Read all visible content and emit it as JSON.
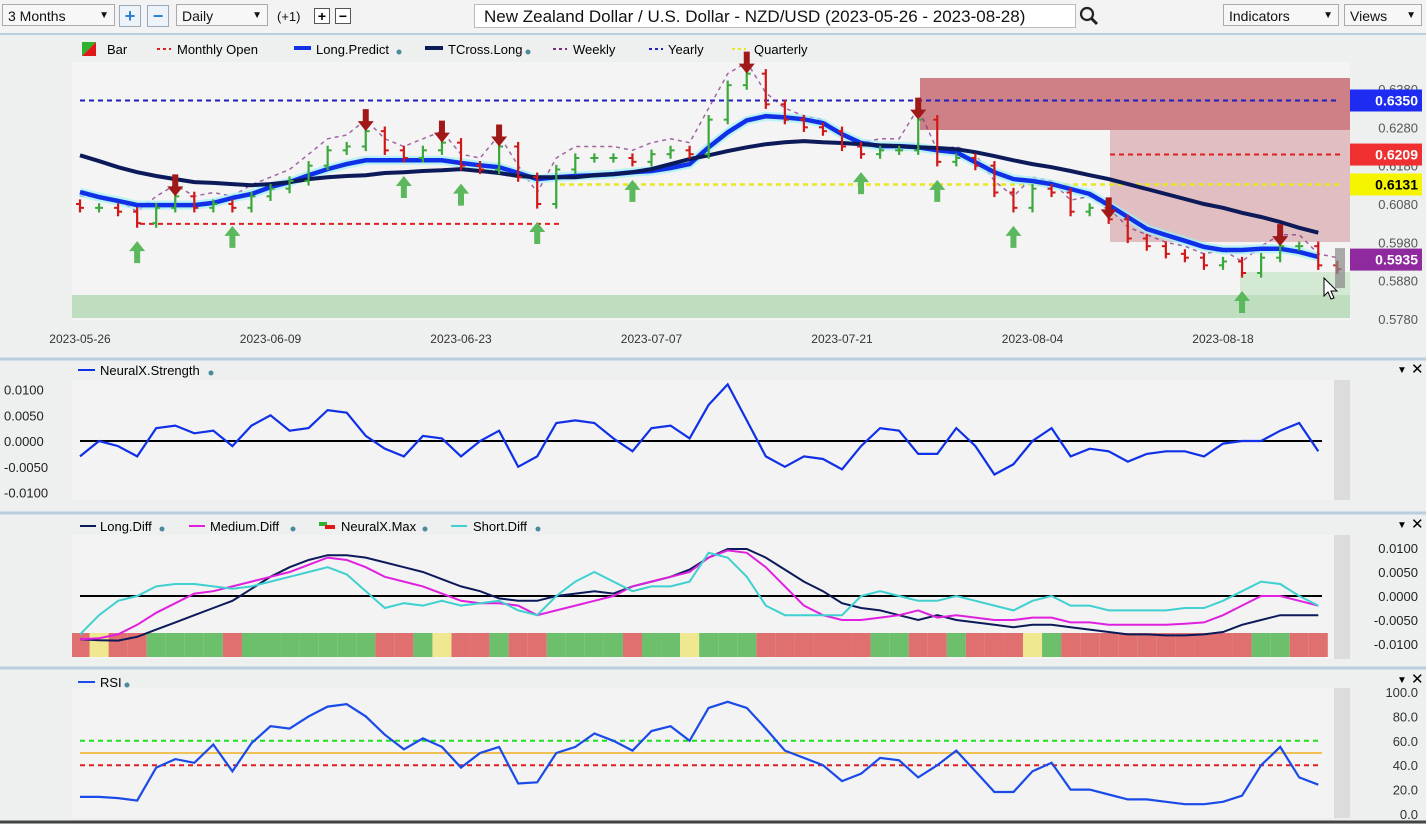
{
  "toolbar": {
    "range_select": "3 Months",
    "interval_select": "Daily",
    "offset_label": "(+1)",
    "title": "New Zealand Dollar / U.S. Dollar - NZD/USD (2023-05-26 - 2023-08-28)",
    "indicators_label": "Indicators",
    "views_label": "Views",
    "icons": [
      "plus-icon",
      "minus-icon",
      "search-icon",
      "chevron-down-icon"
    ]
  },
  "colors": {
    "up": "#3aa83a",
    "down": "#d01818",
    "long_predict": "#1030e8",
    "tcross": "#0c1a5a",
    "yearly": "#2020c0",
    "monthly": "#e02020",
    "quarterly": "#e8e820",
    "weekly": "#7a2a80",
    "long_diff": "#0c1a5a",
    "medium_diff": "#e020e0",
    "short_diff": "#40d0d0",
    "rsi": "#1a4ae8",
    "max_G": "#6cc06c",
    "max_R": "#e07070",
    "max_Y": "#f0e890"
  },
  "chart_data": [
    {
      "type": "bar",
      "panel": "price",
      "legend": [
        "Bar",
        "Monthly Open",
        "Long.Predict",
        "TCross.Long",
        "Weekly",
        "Yearly",
        "Quarterly"
      ],
      "x_ticks": [
        "2023-05-26",
        "2023-06-09",
        "2023-06-23",
        "2023-07-07",
        "2023-07-21",
        "2023-08-04",
        "2023-08-18"
      ],
      "y_ticks": [
        "0.6380",
        "0.6280",
        "0.6180",
        "0.6080",
        "0.5980",
        "0.5880",
        "0.5780"
      ],
      "ylim": [
        0.578,
        0.638
      ],
      "closes": [
        0.607,
        0.607,
        0.606,
        0.603,
        0.607,
        0.61,
        0.607,
        0.608,
        0.607,
        0.61,
        0.612,
        0.614,
        0.618,
        0.622,
        0.623,
        0.627,
        0.622,
        0.62,
        0.622,
        0.624,
        0.618,
        0.617,
        0.623,
        0.615,
        0.608,
        0.617,
        0.62,
        0.62,
        0.62,
        0.619,
        0.621,
        0.622,
        0.621,
        0.63,
        0.639,
        0.642,
        0.634,
        0.63,
        0.628,
        0.627,
        0.623,
        0.621,
        0.622,
        0.622,
        0.63,
        0.619,
        0.62,
        0.618,
        0.611,
        0.607,
        0.612,
        0.611,
        0.606,
        0.607,
        0.604,
        0.599,
        0.597,
        0.595,
        0.594,
        0.592,
        0.593,
        0.59,
        0.594,
        0.597,
        0.597,
        0.592,
        0.591
      ],
      "long_predict": [
        0.6111,
        0.6098,
        0.6088,
        0.6077,
        0.6077,
        0.6077,
        0.6077,
        0.6083,
        0.6096,
        0.6106,
        0.6124,
        0.6137,
        0.6155,
        0.6171,
        0.6184,
        0.6194,
        0.6194,
        0.6194,
        0.6194,
        0.6194,
        0.6187,
        0.6181,
        0.6176,
        0.6161,
        0.6145,
        0.615,
        0.6153,
        0.6155,
        0.6158,
        0.6163,
        0.6166,
        0.6174,
        0.6184,
        0.6228,
        0.6267,
        0.6298,
        0.6309,
        0.6306,
        0.6301,
        0.6291,
        0.6262,
        0.6239,
        0.6231,
        0.6231,
        0.6228,
        0.622,
        0.6215,
        0.6189,
        0.6163,
        0.6145,
        0.614,
        0.6132,
        0.6119,
        0.6106,
        0.6077,
        0.6046,
        0.6015,
        0.5999,
        0.5984,
        0.5968,
        0.596,
        0.596,
        0.5963,
        0.5963,
        0.5955,
        0.5942
      ],
      "tcross_long": [
        0.6207,
        0.6192,
        0.6176,
        0.6163,
        0.6153,
        0.6145,
        0.6137,
        0.6135,
        0.6132,
        0.6129,
        0.6132,
        0.6137,
        0.6145,
        0.615,
        0.6153,
        0.6155,
        0.6161,
        0.6163,
        0.6166,
        0.6168,
        0.6171,
        0.6166,
        0.6161,
        0.6153,
        0.615,
        0.615,
        0.615,
        0.6155,
        0.6158,
        0.6163,
        0.6171,
        0.6184,
        0.6197,
        0.6207,
        0.6218,
        0.6228,
        0.6236,
        0.6241,
        0.6244,
        0.6241,
        0.6239,
        0.6236,
        0.6233,
        0.6231,
        0.6228,
        0.6226,
        0.6223,
        0.6215,
        0.6205,
        0.6194,
        0.6184,
        0.6176,
        0.6166,
        0.6155,
        0.6145,
        0.6132,
        0.6119,
        0.6106,
        0.6093,
        0.608,
        0.607,
        0.6057,
        0.6046,
        0.6033,
        0.6018,
        0.6005
      ],
      "levels": [
        {
          "name": "Yearly",
          "value": 0.635,
          "label": "0.6350",
          "color": "#1d2cf0",
          "text_color": "#ffffff"
        },
        {
          "name": "Monthly Open",
          "value": 0.6209,
          "label": "0.6209",
          "color": "#f03030",
          "text_color": "#ffffff"
        },
        {
          "name": "Quarterly",
          "value": 0.6131,
          "label": "0.6131",
          "color": "#f5f500",
          "text_color": "#000000"
        },
        {
          "name": "Long.Predict",
          "value": 0.5935,
          "label": "0.5935",
          "color": "#8e2a9e",
          "text_color": "#ffffff"
        }
      ],
      "signals": [
        {
          "date": "2023-05-31",
          "dir": "up"
        },
        {
          "date": "2023-06-02",
          "dir": "down"
        },
        {
          "date": "2023-06-07",
          "dir": "up"
        },
        {
          "date": "2023-06-16",
          "dir": "down"
        },
        {
          "date": "2023-06-20",
          "dir": "up"
        },
        {
          "date": "2023-06-22",
          "dir": "down"
        },
        {
          "date": "2023-06-23",
          "dir": "up"
        },
        {
          "date": "2023-06-27",
          "dir": "down"
        },
        {
          "date": "2023-06-29",
          "dir": "up"
        },
        {
          "date": "2023-07-06",
          "dir": "up"
        },
        {
          "date": "2023-07-14",
          "dir": "down"
        },
        {
          "date": "2023-07-24",
          "dir": "up"
        },
        {
          "date": "2023-07-27",
          "dir": "down"
        },
        {
          "date": "2023-07-28",
          "dir": "up"
        },
        {
          "date": "2023-08-03",
          "dir": "up"
        },
        {
          "date": "2023-08-10",
          "dir": "down"
        },
        {
          "date": "2023-08-21",
          "dir": "up"
        },
        {
          "date": "2023-08-23",
          "dir": "down"
        }
      ]
    },
    {
      "type": "line",
      "panel": "strength",
      "legend": [
        "NeuralX.Strength"
      ],
      "y_ticks": [
        "0.0100",
        "0.0050",
        "0.0000",
        "-0.0050",
        "-0.0100"
      ],
      "ylim": [
        -0.01,
        0.01
      ],
      "values": [
        -0.003,
        0.0,
        -0.001,
        -0.003,
        0.0025,
        0.003,
        0.0015,
        0.002,
        -0.001,
        0.003,
        0.005,
        0.002,
        0.0025,
        0.006,
        0.0055,
        0.001,
        -0.0015,
        -0.003,
        0.001,
        0.0005,
        -0.003,
        0.0,
        0.002,
        -0.005,
        -0.003,
        0.0035,
        0.004,
        0.0035,
        0.0005,
        -0.002,
        0.0025,
        0.003,
        0.0005,
        0.007,
        0.011,
        0.004,
        -0.003,
        -0.005,
        -0.003,
        -0.0035,
        -0.0055,
        -0.001,
        0.0025,
        0.002,
        -0.0025,
        -0.0025,
        0.0025,
        -0.001,
        -0.0065,
        -0.0045,
        0.0,
        0.0025,
        -0.003,
        -0.0015,
        -0.002,
        -0.004,
        -0.0025,
        -0.002,
        -0.002,
        -0.003,
        -0.0005,
        0.0,
        0.0,
        0.002,
        0.0035,
        -0.002
      ]
    },
    {
      "type": "line",
      "panel": "diff",
      "legend": [
        "Long.Diff",
        "Medium.Diff",
        "NeuralX.Max",
        "Short.Diff"
      ],
      "y_ticks": [
        "0.0100",
        "0.0050",
        "0.0000",
        "-0.0050",
        "-0.0100"
      ],
      "ylim": [
        -0.01,
        0.01
      ],
      "series": [
        {
          "name": "Long.Diff",
          "values": [
            -0.009,
            -0.0092,
            -0.0093,
            -0.0085,
            -0.007,
            -0.0055,
            -0.004,
            -0.0025,
            -0.001,
            0.0015,
            0.004,
            0.006,
            0.0075,
            0.0085,
            0.0085,
            0.008,
            0.007,
            0.006,
            0.005,
            0.0035,
            0.002,
            0.001,
            -0.0005,
            -0.001,
            -0.001,
            0.0,
            0.0005,
            0.001,
            0.0005,
            0.002,
            0.003,
            0.004,
            0.0055,
            0.008,
            0.0098,
            0.0098,
            0.008,
            0.0055,
            0.003,
            0.001,
            -0.0015,
            -0.0025,
            -0.003,
            -0.004,
            -0.005,
            -0.004,
            -0.005,
            -0.0055,
            -0.006,
            -0.0065,
            -0.006,
            -0.006,
            -0.0065,
            -0.007,
            -0.0075,
            -0.008,
            -0.008,
            -0.0082,
            -0.0082,
            -0.008,
            -0.0075,
            -0.006,
            -0.005,
            -0.004,
            -0.004,
            -0.004
          ]
        },
        {
          "name": "Medium.Diff",
          "values": [
            -0.009,
            -0.0088,
            -0.008,
            -0.006,
            -0.0035,
            -0.0015,
            0.0005,
            0.001,
            0.002,
            0.003,
            0.004,
            0.005,
            0.0065,
            0.008,
            0.0075,
            0.006,
            0.004,
            0.003,
            0.002,
            0.0005,
            -0.001,
            -0.0015,
            -0.0015,
            -0.002,
            -0.004,
            -0.003,
            -0.002,
            -0.001,
            0.0,
            0.002,
            0.003,
            0.004,
            0.005,
            0.008,
            0.0095,
            0.009,
            0.006,
            0.002,
            -0.002,
            -0.004,
            -0.005,
            -0.005,
            -0.0045,
            -0.004,
            -0.003,
            -0.0045,
            -0.004,
            -0.0045,
            -0.005,
            -0.005,
            -0.0045,
            -0.0045,
            -0.0055,
            -0.0055,
            -0.006,
            -0.006,
            -0.006,
            -0.006,
            -0.0058,
            -0.0055,
            -0.004,
            -0.002,
            0.0,
            0.0,
            -0.001,
            -0.002
          ]
        },
        {
          "name": "Short.Diff",
          "values": [
            -0.008,
            -0.004,
            -0.001,
            0.0,
            0.002,
            0.0025,
            0.0025,
            0.002,
            0.0015,
            0.002,
            0.003,
            0.004,
            0.005,
            0.006,
            0.0045,
            0.001,
            -0.0025,
            -0.0015,
            -0.002,
            -0.001,
            -0.002,
            -0.0015,
            -0.001,
            -0.003,
            -0.004,
            0.0,
            0.003,
            0.005,
            0.003,
            0.001,
            0.002,
            0.002,
            0.003,
            0.009,
            0.008,
            0.004,
            -0.002,
            -0.004,
            -0.004,
            -0.004,
            -0.004,
            0.0,
            0.001,
            0.0,
            -0.001,
            -0.001,
            0.0,
            -0.001,
            -0.002,
            -0.003,
            -0.001,
            0.0,
            -0.002,
            -0.002,
            -0.003,
            -0.003,
            -0.003,
            -0.003,
            -0.0025,
            -0.0025,
            -0.001,
            0.001,
            0.003,
            0.0025,
            0.0,
            -0.002
          ]
        }
      ],
      "neuralx_max": [
        "R",
        "Y",
        "R",
        "R",
        "G",
        "G",
        "G",
        "G",
        "R",
        "G",
        "G",
        "G",
        "G",
        "G",
        "G",
        "G",
        "R",
        "R",
        "G",
        "Y",
        "R",
        "R",
        "G",
        "R",
        "R",
        "G",
        "G",
        "G",
        "G",
        "R",
        "G",
        "G",
        "Y",
        "G",
        "G",
        "G",
        "R",
        "R",
        "R",
        "R",
        "R",
        "R",
        "G",
        "G",
        "R",
        "R",
        "G",
        "R",
        "R",
        "R",
        "Y",
        "G",
        "R",
        "R",
        "R",
        "R",
        "R",
        "R",
        "R",
        "R",
        "R",
        "R",
        "G",
        "G",
        "R",
        "R"
      ]
    },
    {
      "type": "line",
      "panel": "rsi",
      "legend": [
        "RSI"
      ],
      "y_ticks": [
        "100.0",
        "80.0",
        "60.0",
        "40.0",
        "20.0",
        "0.0"
      ],
      "ylim": [
        0,
        100
      ],
      "levels": [
        60,
        50,
        40
      ],
      "values": [
        14,
        14,
        13,
        11,
        38,
        45,
        42,
        57,
        35,
        58,
        72,
        70,
        80,
        88,
        90,
        80,
        65,
        53,
        62,
        55,
        38,
        50,
        55,
        25,
        26,
        50,
        55,
        66,
        60,
        52,
        68,
        72,
        60,
        87,
        92,
        87,
        70,
        52,
        46,
        40,
        27,
        33,
        46,
        44,
        30,
        40,
        52,
        35,
        18,
        18,
        35,
        42,
        20,
        20,
        16,
        12,
        12,
        10,
        8,
        8,
        10,
        15,
        40,
        55,
        30,
        24
      ]
    }
  ]
}
